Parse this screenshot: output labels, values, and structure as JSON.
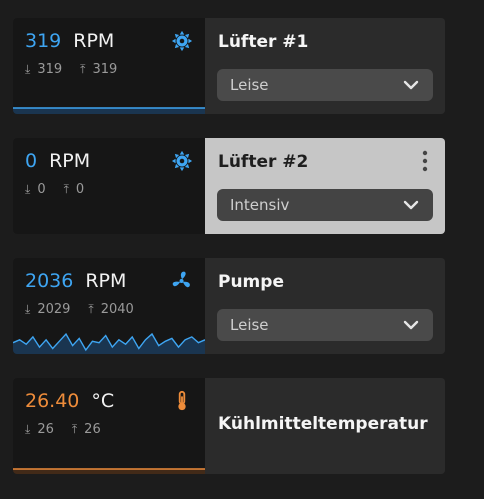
{
  "colors": {
    "blue": "#3ea5f2",
    "orange": "#ee8c3a",
    "card_bg": "#2b2b2b",
    "highlight_bg": "#c6c6c6"
  },
  "cards": [
    {
      "title": "Lüfter #1",
      "value": "319",
      "unit": "RPM",
      "min": "319",
      "max": "319",
      "value_color": "#3ea5f2",
      "icon": "fan-icon",
      "dropdown": "Leise",
      "highlighted": false
    },
    {
      "title": "Lüfter #2",
      "value": "0",
      "unit": "RPM",
      "min": "0",
      "max": "0",
      "value_color": "#3ea5f2",
      "icon": "fan-icon",
      "dropdown": "Intensiv",
      "highlighted": true,
      "menu_icon": "more-vertical-icon"
    },
    {
      "title": "Pumpe",
      "value": "2036",
      "unit": "RPM",
      "min": "2029",
      "max": "2040",
      "value_color": "#3ea5f2",
      "icon": "pump-icon",
      "dropdown": "Leise",
      "highlighted": false
    },
    {
      "title": "Kühlmitteltemperatur",
      "value": "26.40",
      "unit": "°C",
      "min": "26",
      "max": "26",
      "value_color": "#ee8c3a",
      "icon": "thermometer-icon",
      "highlighted": false
    }
  ],
  "chart_data": [
    {
      "type": "area",
      "series": [
        {
          "values": [
            319,
            319,
            319,
            319,
            319
          ]
        }
      ]
    },
    {
      "type": "area",
      "series": [
        {
          "values": [
            2034,
            2036,
            2033,
            2038,
            2031,
            2036,
            2030,
            2035,
            2040,
            2032,
            2037,
            2029,
            2035,
            2034,
            2039,
            2031,
            2036,
            2033,
            2038,
            2030,
            2036,
            2040,
            2032,
            2035,
            2037,
            2031,
            2036,
            2038,
            2034,
            2036
          ]
        }
      ]
    },
    {
      "type": "area",
      "series": [
        {
          "values": [
            26,
            26,
            26,
            26,
            26
          ]
        }
      ]
    }
  ]
}
